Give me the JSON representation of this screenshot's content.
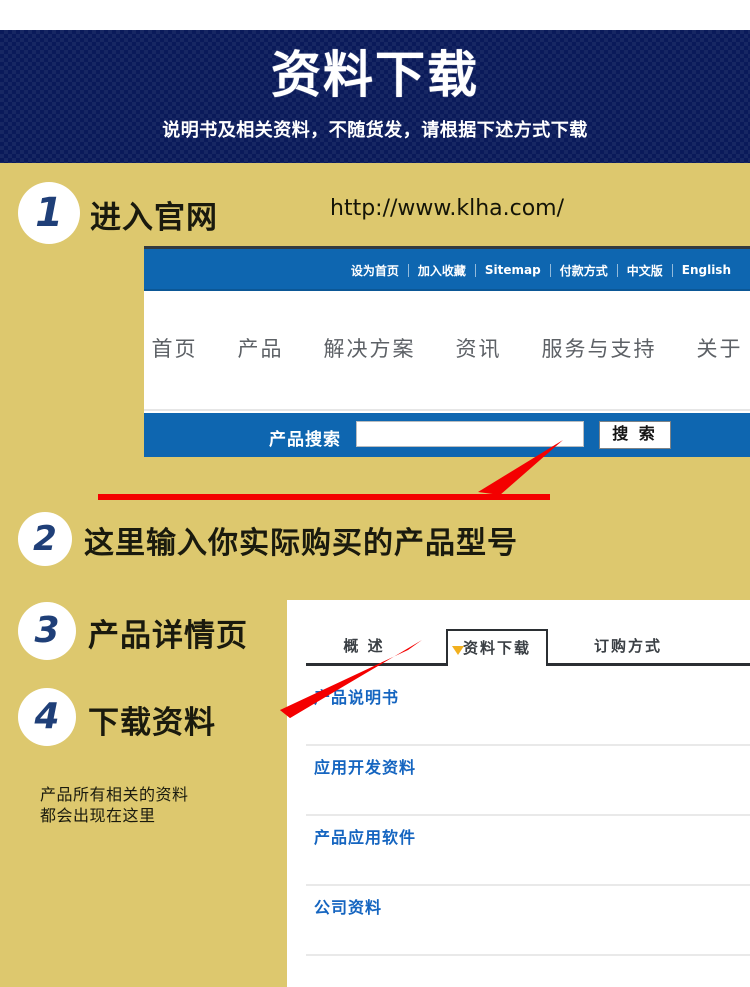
{
  "banner": {
    "title": "资料下载",
    "subtitle": "说明书及相关资料，不随货发，请根据下述方式下载"
  },
  "steps": [
    {
      "number": "1",
      "label": "进入官网"
    },
    {
      "number": "2",
      "label": "这里输入你实际购买的产品型号"
    },
    {
      "number": "3",
      "label": "产品详情页"
    },
    {
      "number": "4",
      "label": "下载资料"
    }
  ],
  "url": "http://www.klha.com/",
  "note": "产品所有相关的资料\n都会出现在这里",
  "note_line1": "产品所有相关的资料",
  "note_line2": "都会出现在这里",
  "site": {
    "utility": [
      "设为首页",
      "加入收藏",
      "Sitemap",
      "付款方式",
      "中文版",
      "English"
    ],
    "nav": [
      "首页",
      "产品",
      "解决方案",
      "资讯",
      "服务与支持",
      "关于"
    ],
    "search": {
      "label": "产品搜索",
      "value": "",
      "placeholder": "",
      "button": "搜 索"
    }
  },
  "detail": {
    "tabs": [
      {
        "label": "概 述",
        "active": false
      },
      {
        "label": "资料下载",
        "active": true
      },
      {
        "label": "订购方式",
        "active": false
      }
    ],
    "downloads": [
      "产品说明书",
      "应用开发资料",
      "产品应用软件",
      "公司资料"
    ]
  },
  "colors": {
    "banner_blue": "#0c1f6b",
    "body_khaki": "#ddc86e",
    "site_blue": "#0e66b0",
    "link_blue": "#1565c0",
    "arrow_red": "#f40000",
    "marker_yellow": "#f2b01e",
    "number_blue": "#1f3f78"
  }
}
